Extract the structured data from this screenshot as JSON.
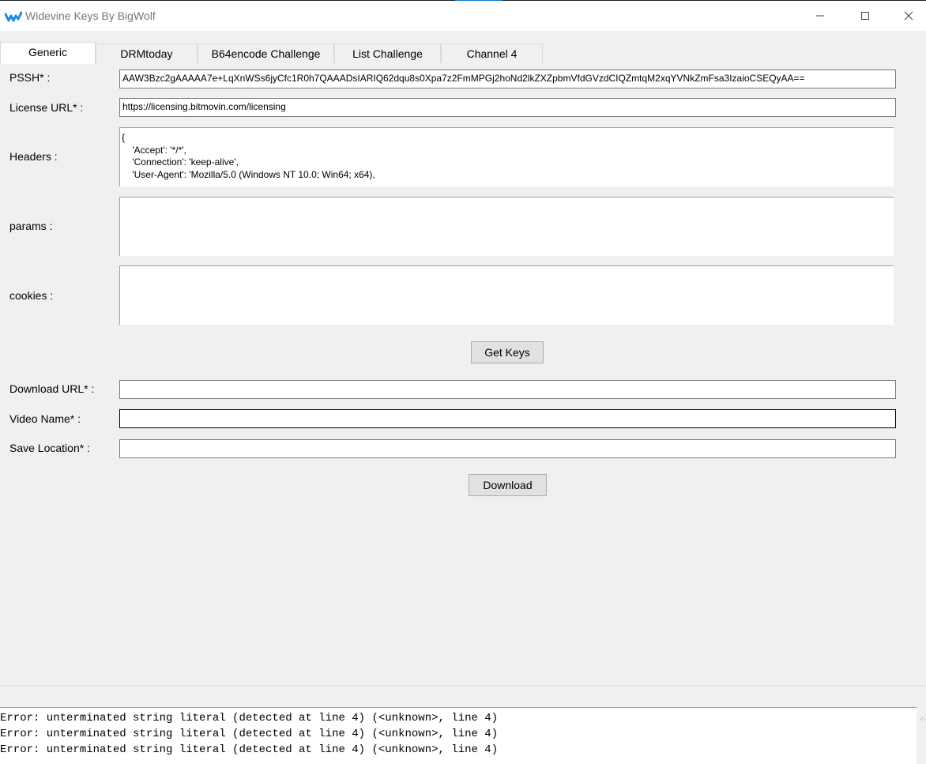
{
  "window": {
    "title": "Widevine Keys By BigWolf",
    "accent_color": "#0078d7"
  },
  "titlebar_buttons": {
    "minimize_glyph": "—",
    "maximize_glyph": "☐",
    "close_glyph": "✕"
  },
  "tabs": [
    {
      "label": "Generic",
      "active": true
    },
    {
      "label": "DRMtoday",
      "active": false
    },
    {
      "label": "B64encode Challenge",
      "active": false
    },
    {
      "label": "List Challenge",
      "active": false
    },
    {
      "label": "Channel 4",
      "active": false
    }
  ],
  "form": {
    "pssh_label": "PSSH* :",
    "pssh_value": "AAW3Bzc2gAAAAA7e+LqXnWSs6jyCfc1R0h7QAAADsIARIQ62dqu8s0Xpa7z2FmMPGj2hoNd2lkZXZpbmVfdGVzdCIQZmtqM2xqYVNkZmFsa3IzaioCSEQyAA==",
    "license_url_label": "License URL* :",
    "license_url_value": "https://licensing.bitmovin.com/licensing",
    "headers_label": "Headers :",
    "headers_value": "{\n    'Accept': '*/*',\n    'Connection': 'keep-alive',\n    'User-Agent': 'Mozilla/5.0 (Windows NT 10.0; Win64; x64),",
    "params_label": "params :",
    "params_value": "",
    "cookies_label": "cookies :",
    "cookies_value": "",
    "get_keys_button": "Get Keys",
    "download_url_label": "Download URL* :",
    "download_url_value": "",
    "video_name_label": "Video Name* :",
    "video_name_value": "",
    "save_location_label": "Save Location* :",
    "save_location_value": "",
    "download_button": "Download"
  },
  "log": {
    "lines": [
      "Error: unterminated string literal (detected at line 4) (<unknown>, line 4)",
      "Error: unterminated string literal (detected at line 4) (<unknown>, line 4)",
      "Error: unterminated string literal (detected at line 4) (<unknown>, line 4)"
    ]
  }
}
